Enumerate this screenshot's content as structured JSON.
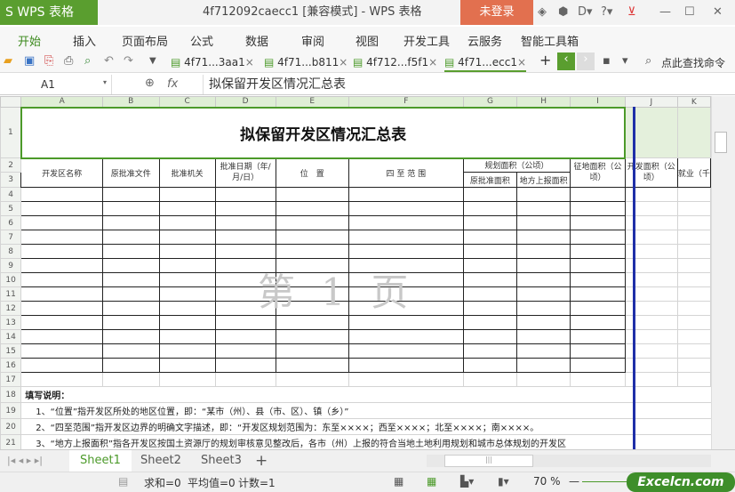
{
  "app": {
    "name": "S WPS 表格",
    "title": "4f712092caecc1 [兼容模式] - WPS 表格",
    "login": "未登录"
  },
  "menu": [
    "开始",
    "插入",
    "页面布局",
    "公式",
    "数据",
    "审阅",
    "视图",
    "开发工具",
    "云服务",
    "智能工具箱"
  ],
  "doc_tabs": [
    "4f71...3aa1",
    "4f71...b811",
    "4f712...f5f1",
    "4f71...ecc1"
  ],
  "search_cmd": "点此查找命令",
  "formula_bar": {
    "cell": "A1",
    "fx": "fx",
    "value": "拟保留开发区情况汇总表"
  },
  "columns": [
    "A",
    "B",
    "C",
    "D",
    "E",
    "F",
    "G",
    "H",
    "I",
    "J",
    "K"
  ],
  "sheet": {
    "title": "拟保留开发区情况汇总表",
    "headers": {
      "a": "开发区名称",
      "b": "原批准文件",
      "c": "批准机关",
      "d": "批准日期（年/月/日）",
      "e": "位　置",
      "f": "四 至 范 围",
      "gh": "规划面积（公顷）",
      "g": "原批准面积",
      "h": "地方上报面积",
      "i": "征地面积（公顷）",
      "j": "开发面积（公顷）",
      "k": "就业（千"
    },
    "notes_title": "填写说明：",
    "notes": [
      "1、“位置”指开发区所处的地区位置，即：“某市（州）、县（市、区）、镇（乡）”",
      "2、“四至范围”指开发区边界的明确文字描述，即：“开发区规划范围为：东至××××；西至××××；北至××××；南××××。",
      "3、“地方上报面积”指各开发区按国土资源厅的规划审核意见整改后，各市（州）上报的符合当地土地利用规划和城市总体规划的开发区"
    ],
    "watermark": "第 1 页"
  },
  "sheet_tabs": [
    "Sheet1",
    "Sheet2",
    "Sheet3"
  ],
  "status": {
    "sum": "求和=0",
    "avg": "平均值=0",
    "count": "计数=1",
    "zoom": "70 %"
  },
  "watermark_logo": "Excelcn.com"
}
